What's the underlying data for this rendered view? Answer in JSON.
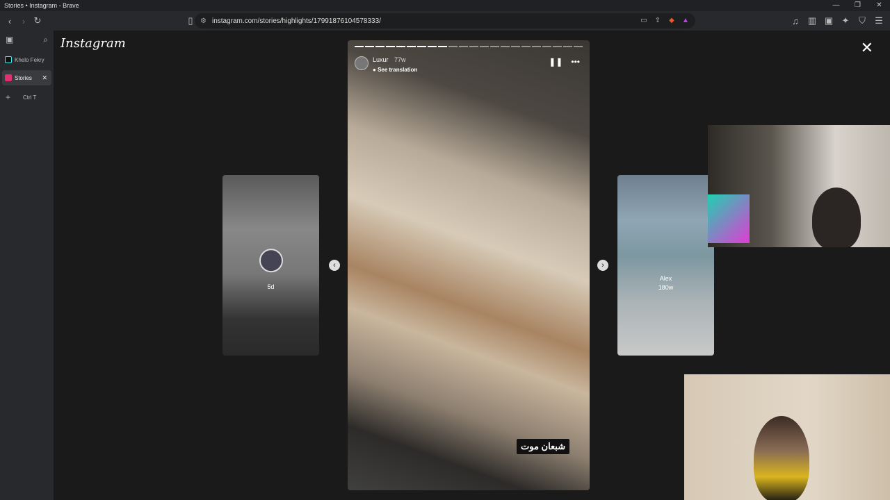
{
  "window": {
    "title": "Stories • Instagram - Brave",
    "controls": [
      "—",
      "❐",
      "✕"
    ]
  },
  "toolbar": {
    "url": "instagram.com/stories/highlights/17991876104578333/"
  },
  "sidebar": {
    "tabs": [
      {
        "label": "Khelo Fekry",
        "active": false,
        "color": "#111111"
      },
      {
        "label": "Stories",
        "active": true,
        "color": "#e1306c"
      }
    ],
    "new_tab_shortcut": "Ctrl  T"
  },
  "instagram": {
    "logo": "Instagram"
  },
  "story": {
    "username": "Luxur",
    "time": "77w",
    "translate": "See translation",
    "caption": "شبعان موت",
    "progress_segments": 22,
    "progress_done": 9
  },
  "prev_card": {
    "time": "5d"
  },
  "next_card": {
    "name": "Alex",
    "time": "180w"
  }
}
